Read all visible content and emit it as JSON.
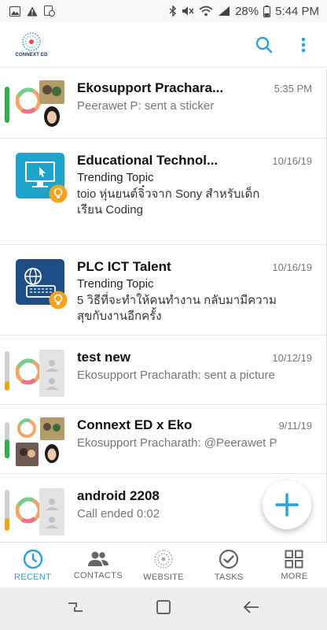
{
  "status_bar": {
    "battery": "28%",
    "time": "5:44 PM"
  },
  "app_bar": {
    "logo_text": "CONNEXT ED"
  },
  "colors": {
    "accent": "#2aa2d6",
    "green": "#2db24a",
    "orange": "#f6a21a",
    "gray": "#bdbdbd"
  },
  "chats": [
    {
      "title": "Ekosupport Prachara...",
      "time": "5:35 PM",
      "message": "Peerawet P: sent a sticker"
    },
    {
      "title": "Educational Technol...",
      "time": "10/16/19",
      "subtitle": "Trending Topic",
      "message": "toio หุ่นยนต์จิ๋วจาก Sony สำหรับเด็กเรียน Coding"
    },
    {
      "title": "PLC ICT Talent",
      "time": "10/16/19",
      "subtitle": "Trending Topic",
      "message": "5 วิธีที่จะทำให้คนทำงาน กลับมามีความสุขกับงานอีกครั้ง"
    },
    {
      "title": "test new",
      "time": "10/12/19",
      "message": "Ekosupport Pracharath: sent a picture"
    },
    {
      "title": "Connext ED x Eko",
      "time": "9/11/19",
      "message": "Ekosupport Pracharath: @Peerawet P"
    },
    {
      "title": "android 2208",
      "time": "",
      "message": "Call ended 0:02"
    }
  ],
  "bottom_nav": {
    "items": [
      {
        "label": "RECENT",
        "icon": "clock-icon"
      },
      {
        "label": "CONTACTS",
        "icon": "people-icon"
      },
      {
        "label": "WEBSITE",
        "icon": "website-icon"
      },
      {
        "label": "TASKS",
        "icon": "check-circle-icon"
      },
      {
        "label": "MORE",
        "icon": "grid-icon"
      }
    ]
  }
}
